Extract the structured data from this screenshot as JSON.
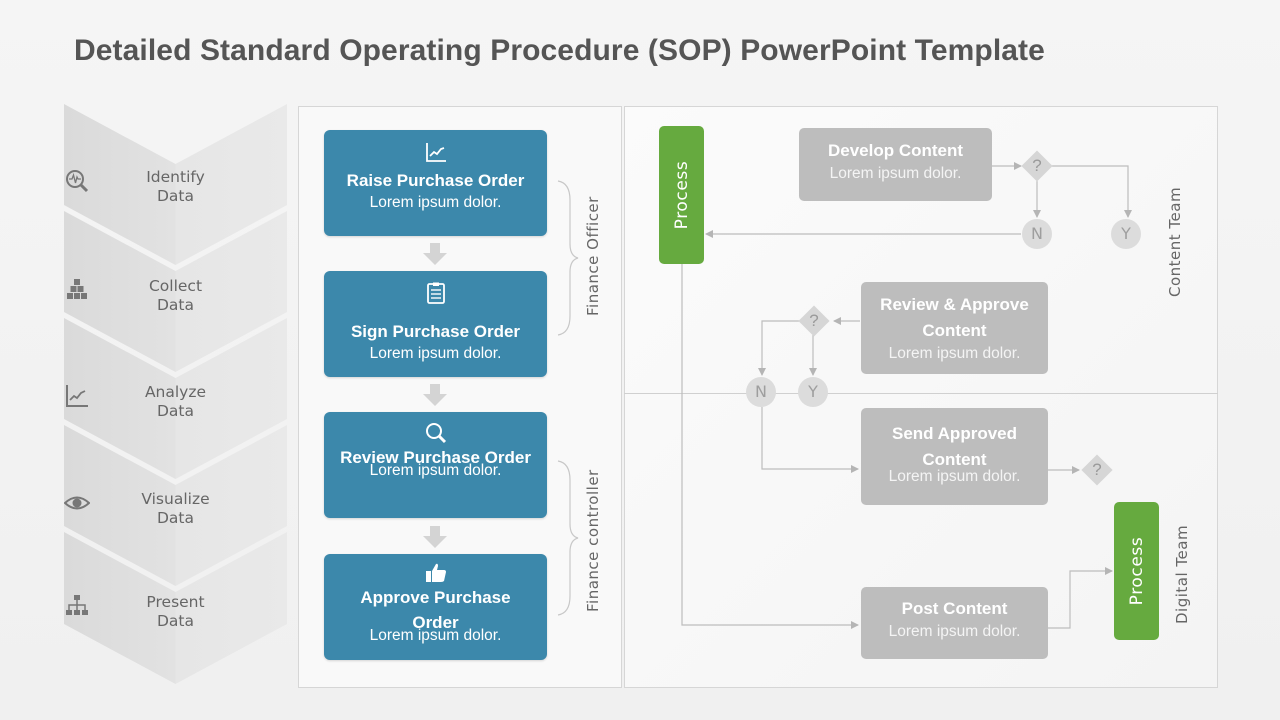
{
  "title": "Detailed Standard Operating Procedure (SOP) PowerPoint Template",
  "colors": {
    "blue": "#3c88ab",
    "green": "#66aa3f",
    "gray_box": "#bdbdbd",
    "title": "#555555"
  },
  "steps": [
    {
      "icon": "data-search-icon",
      "line1": "Identify",
      "line2": "Data"
    },
    {
      "icon": "boxes-stack-icon",
      "line1": "Collect",
      "line2": "Data"
    },
    {
      "icon": "line-chart-icon",
      "line1": "Analyze",
      "line2": "Data"
    },
    {
      "icon": "eye-icon",
      "line1": "Visualize",
      "line2": "Data"
    },
    {
      "icon": "org-chart-icon",
      "line1": "Present",
      "line2": "Data"
    }
  ],
  "finance": {
    "boxes": [
      {
        "icon": "line-chart-icon",
        "title": "Raise Purchase Order",
        "subtitle": "Lorem ipsum dolor."
      },
      {
        "icon": "clipboard-icon",
        "title": "Sign Purchase Order",
        "subtitle": "Lorem ipsum dolor."
      },
      {
        "icon": "search-icon",
        "title": "Review Purchase Order",
        "subtitle": "Lorem ipsum dolor."
      },
      {
        "icon": "thumbs-up-icon",
        "title": "Approve Purchase Order",
        "subtitle": "Lorem ipsum dolor."
      }
    ],
    "roles": [
      "Finance Officer",
      "Finance controller"
    ]
  },
  "flow": {
    "process_label": "Process",
    "team_labels": [
      "Content Team",
      "Digital Team"
    ],
    "boxes": [
      {
        "title": "Develop Content",
        "subtitle": "Lorem ipsum dolor."
      },
      {
        "title": "Review & Approve Content",
        "subtitle": "Lorem ipsum dolor."
      },
      {
        "title": "Send Approved Content",
        "subtitle": "Lorem ipsum dolor."
      },
      {
        "title": "Post Content",
        "subtitle": "Lorem ipsum dolor."
      }
    ],
    "decision_symbol": "?",
    "no_label": "N",
    "yes_label": "Y"
  }
}
